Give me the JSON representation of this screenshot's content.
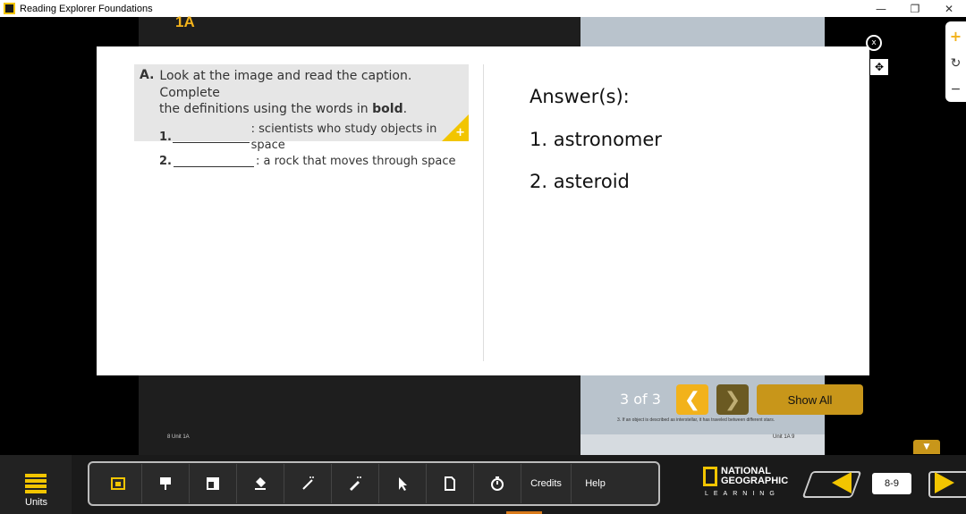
{
  "window": {
    "title": "Reading Explorer Foundations",
    "controls": {
      "minimize": "—",
      "restore": "❐",
      "close": "✕"
    }
  },
  "book": {
    "unit_tag": "1A",
    "footer_left": "8 Unit 1A",
    "footer_right": "Unit 1A 9",
    "note": "3. If an object is described as interstellar, it has traveled between different stars."
  },
  "popup": {
    "question": {
      "letter": "A.",
      "line1": "Look at the image and read the caption. Complete",
      "line2_prefix": "the definitions using the words in ",
      "line2_bold": "bold",
      "line2_suffix": ".",
      "items": [
        {
          "num": "1.",
          "definition": ": scientists who study objects in space"
        },
        {
          "num": "2.",
          "definition": ": a rock that moves through space"
        }
      ]
    },
    "answer_title": "Answer(s):",
    "answers": [
      "1. astronomer",
      "2. asteroid"
    ],
    "close_label": "x",
    "move_icon": "✥"
  },
  "pager": {
    "text": "3  of  3",
    "prev_icon": "❮",
    "next_icon": "❯",
    "show_all": "Show All"
  },
  "side_tools": {
    "zoom_in": "+",
    "reset": "↻",
    "zoom_out": "−"
  },
  "bottom": {
    "units_label": "Units",
    "tools": {
      "credits": "Credits",
      "help": "Help"
    },
    "brand_line1": "NATIONAL",
    "brand_line2": "GEOGRAPHIC",
    "brand_sub": "LEARNING",
    "page_number": "8-9",
    "collapse_icon": "▼"
  },
  "colors": {
    "accent": "#f2c500",
    "gold": "#c8961a"
  }
}
